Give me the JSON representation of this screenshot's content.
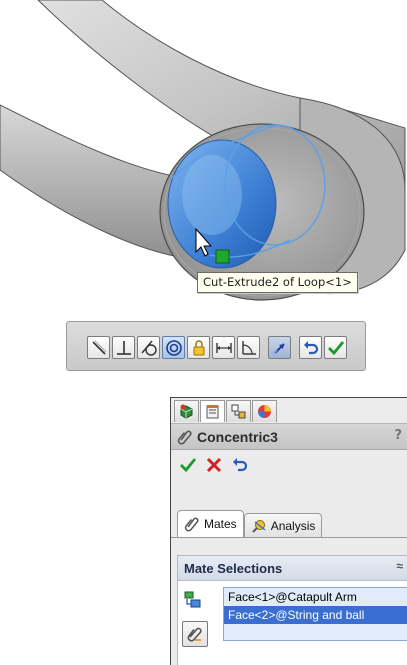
{
  "viewport": {
    "tooltip_text": "Cut-Extrude2 of Loop<1>",
    "colors": {
      "part": "#c8c8c8",
      "selected_face": "#4f8fde",
      "edge_highlight": "#5aa0e8",
      "selection_marker": "#1fa82e"
    }
  },
  "mate_toolbar": {
    "buttons": [
      {
        "icon": "coincident-icon"
      },
      {
        "icon": "perpendicular-icon"
      },
      {
        "icon": "tangent-icon"
      },
      {
        "icon": "concentric-icon",
        "active": true
      },
      {
        "icon": "lock-icon"
      },
      {
        "icon": "distance-icon"
      },
      {
        "icon": "angle-icon"
      },
      {
        "icon": "flip-alignment-icon"
      },
      {
        "icon": "undo-icon"
      },
      {
        "icon": "ok-check-icon"
      }
    ]
  },
  "property_manager": {
    "tabs": [
      "feature-manager-tab-icon",
      "property-manager-tab-icon",
      "configuration-manager-tab-icon",
      "appearance-tab-icon"
    ],
    "title": "Concentric3",
    "help": "?",
    "actions": [
      "ok-icon",
      "cancel-icon",
      "undo-icon"
    ],
    "subtabs": [
      {
        "label": "Mates",
        "icon": "mates-tab-icon",
        "active": true
      },
      {
        "label": "Analysis",
        "icon": "analysis-tab-icon",
        "active": false
      }
    ],
    "mate_selections": {
      "header": "Mate Selections",
      "collapse": "≈",
      "items": [
        {
          "text": "Face<1>@Catapult Arm",
          "highlight": false
        },
        {
          "text": "Face<2>@String and ball",
          "highlight": true
        }
      ]
    }
  }
}
